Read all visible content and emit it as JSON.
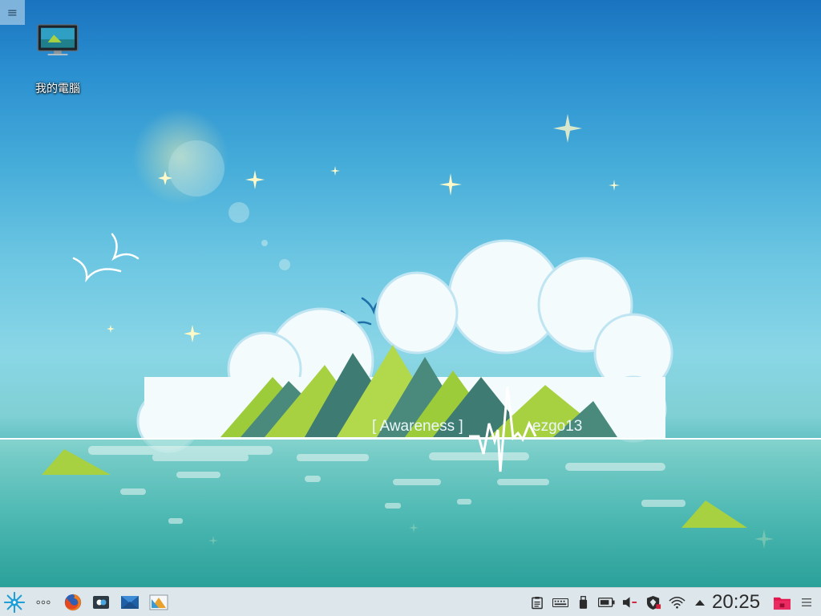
{
  "desktop": {
    "icons": [
      {
        "label": "我的電腦",
        "icon": "computer-monitor-icon"
      }
    ],
    "wallpaper": {
      "caption_left": "[ Awareness ]",
      "caption_right": "ezgo13",
      "colors": {
        "sky_top": "#1a73bf",
        "sky_mid": "#6cc6e2",
        "sea": "#2aa49f",
        "hills": "#9ccc3a"
      }
    }
  },
  "taskbar": {
    "launcher_icon": "kde-star-launcher-icon",
    "launchers": [
      {
        "name": "more-apps-icon"
      },
      {
        "name": "firefox-icon"
      },
      {
        "name": "screen-capture-icon"
      },
      {
        "name": "mail-icon"
      },
      {
        "name": "app-icon"
      }
    ],
    "tray": [
      {
        "name": "clipboard-icon"
      },
      {
        "name": "keyboard-icon"
      },
      {
        "name": "usb-device-icon"
      },
      {
        "name": "battery-icon"
      },
      {
        "name": "volume-muted-icon"
      },
      {
        "name": "security-shield-icon"
      },
      {
        "name": "wifi-icon"
      },
      {
        "name": "tray-expand-arrow-icon"
      }
    ],
    "clock": "20:25",
    "folder_icon": "folder-icon",
    "menu_icon": "panel-menu-icon"
  }
}
